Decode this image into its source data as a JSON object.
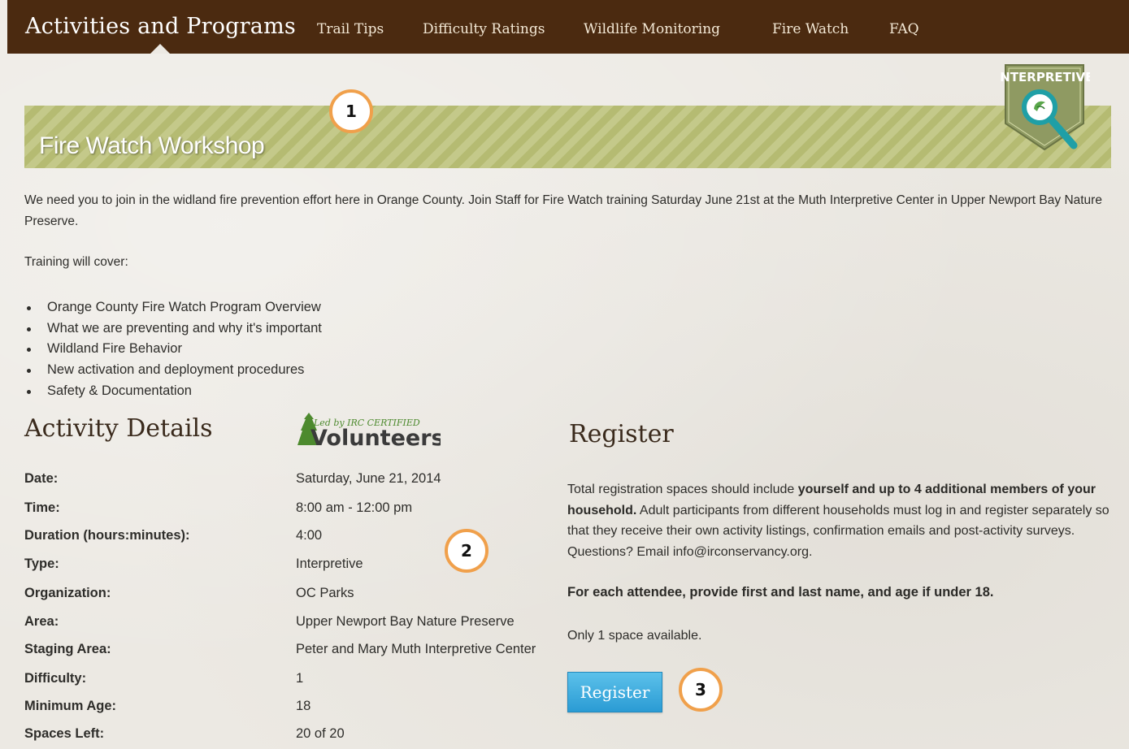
{
  "nav": {
    "title": "Activities and Programs",
    "links": [
      "Trail Tips",
      "Difficulty Ratings",
      "Wildlife Monitoring",
      "Fire Watch",
      "FAQ"
    ]
  },
  "banner": {
    "title": "Fire Watch Workshop",
    "badge_text": "INTERPRETIVE"
  },
  "callouts": [
    "1",
    "2",
    "3"
  ],
  "intro": "We need you to join in the widland fire prevention effort here in Orange County. Join Staff for Fire Watch training Saturday June 21st at the Muth Interpretive Center in Upper Newport Bay Nature Preserve.",
  "training_label": "Training will cover:",
  "training_items": [
    "Orange County Fire Watch Program Overview",
    "What we are preventing and why it's important",
    "Wildland Fire Behavior",
    "New activation and deployment procedures",
    "Safety & Documentation"
  ],
  "activity": {
    "heading": "Activity Details",
    "logo_small": "Led by IRC CERTIFIED",
    "logo_big": "Volunteers",
    "rows": [
      {
        "label": "Date:",
        "value": "Saturday, June 21, 2014"
      },
      {
        "label": "Time:",
        "value": "8:00 am - 12:00 pm"
      },
      {
        "label": "Duration (hours:minutes):",
        "value": "4:00"
      },
      {
        "label": "Type:",
        "value": "Interpretive"
      },
      {
        "label": "Organization:",
        "value": "OC Parks"
      },
      {
        "label": "Area:",
        "value": "Upper Newport Bay Nature Preserve"
      },
      {
        "label": "Staging Area:",
        "value": "Peter and Mary Muth Interpretive Center"
      },
      {
        "label": "Difficulty:",
        "value": "1"
      },
      {
        "label": "Minimum Age:",
        "value": "18"
      },
      {
        "label": "Spaces Left:",
        "value": "20 of 20"
      }
    ]
  },
  "register": {
    "heading": "Register",
    "text_pre": "Total registration spaces should include ",
    "text_bold": "yourself and up to 4 additional members of your household.",
    "text_post": " Adult participants from different households must log in and register separately so that they receive their own activity listings, confirmation emails and post-activity surveys. Questions? Email info@irconservancy.org.",
    "attendee_note": "For each attendee, provide first and last name, and age if under 18.",
    "availability": "Only 1 space available.",
    "button_label": "Register"
  },
  "colors": {
    "nav_bg": "#4b2a10",
    "banner_stripe_light": "#c4c98a",
    "banner_stripe_dark": "#b5bb72",
    "callout_ring": "#f0a04b",
    "button_blue": "#2a9bd4"
  }
}
